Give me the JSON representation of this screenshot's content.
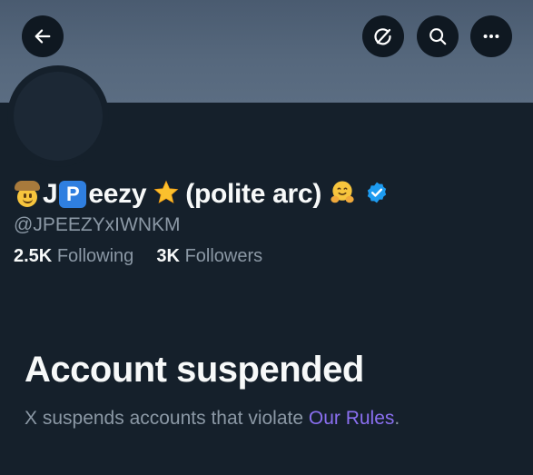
{
  "header": {
    "back_icon": "arrow-left-icon",
    "grok_icon": "grok-icon",
    "search_icon": "search-icon",
    "more_icon": "more-horizontal-icon"
  },
  "profile": {
    "name_part_1": "J",
    "name_badge_letter": "P",
    "name_part_2": "eezy",
    "name_part_3": "(polite arc)",
    "emojis": [
      "cowboy-hat-face",
      "p-button",
      "star",
      "hugging-face"
    ],
    "verified": true,
    "handle": "@JPEEZYxIWNKM",
    "following_count": "2.5K",
    "following_label": "Following",
    "followers_count": "3K",
    "followers_label": "Followers"
  },
  "suspension": {
    "title": "Account suspended",
    "description": "X suspends accounts that violate ",
    "link_text": "Our Rules",
    "trailing": "."
  },
  "colors": {
    "background": "#15202b",
    "secondary_text": "#8b98a5",
    "link": "#8a6ff0",
    "verified": "#1d9bf0"
  }
}
